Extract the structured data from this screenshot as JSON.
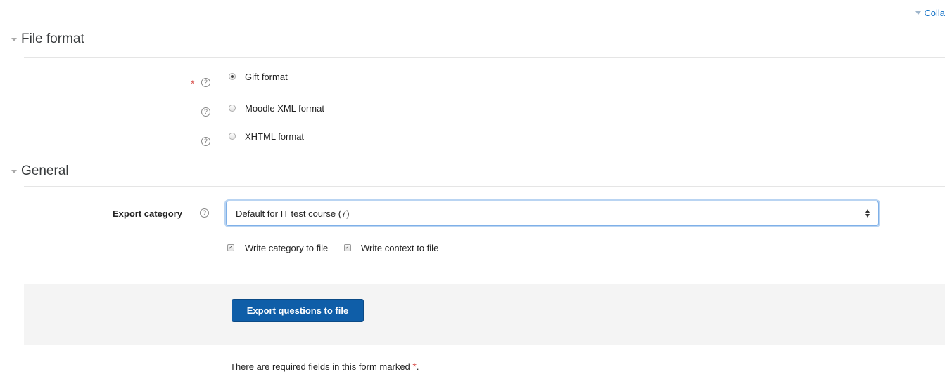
{
  "header": {
    "collapse_all_label": "Colla"
  },
  "sections": {
    "file_format": {
      "title": "File format",
      "options": [
        {
          "label": "Gift format",
          "selected": true
        },
        {
          "label": "Moodle XML format",
          "selected": false
        },
        {
          "label": "XHTML format",
          "selected": false
        }
      ],
      "required_marker": "*",
      "help_glyph": "?"
    },
    "general": {
      "title": "General",
      "export_category": {
        "label": "Export category",
        "value": "Default for IT test course (7)"
      },
      "checkboxes": [
        {
          "label": "Write category to file",
          "checked": true
        },
        {
          "label": "Write context to file",
          "checked": true
        }
      ],
      "check_glyph": "✓"
    }
  },
  "actions": {
    "export_button_label": "Export questions to file"
  },
  "footer": {
    "required_note": "There are required fields in this form marked",
    "required_marker": "*",
    "period": "."
  },
  "colors": {
    "accent": "#0f6fc5",
    "button": "#0f5ea8",
    "required": "#d9534f"
  }
}
